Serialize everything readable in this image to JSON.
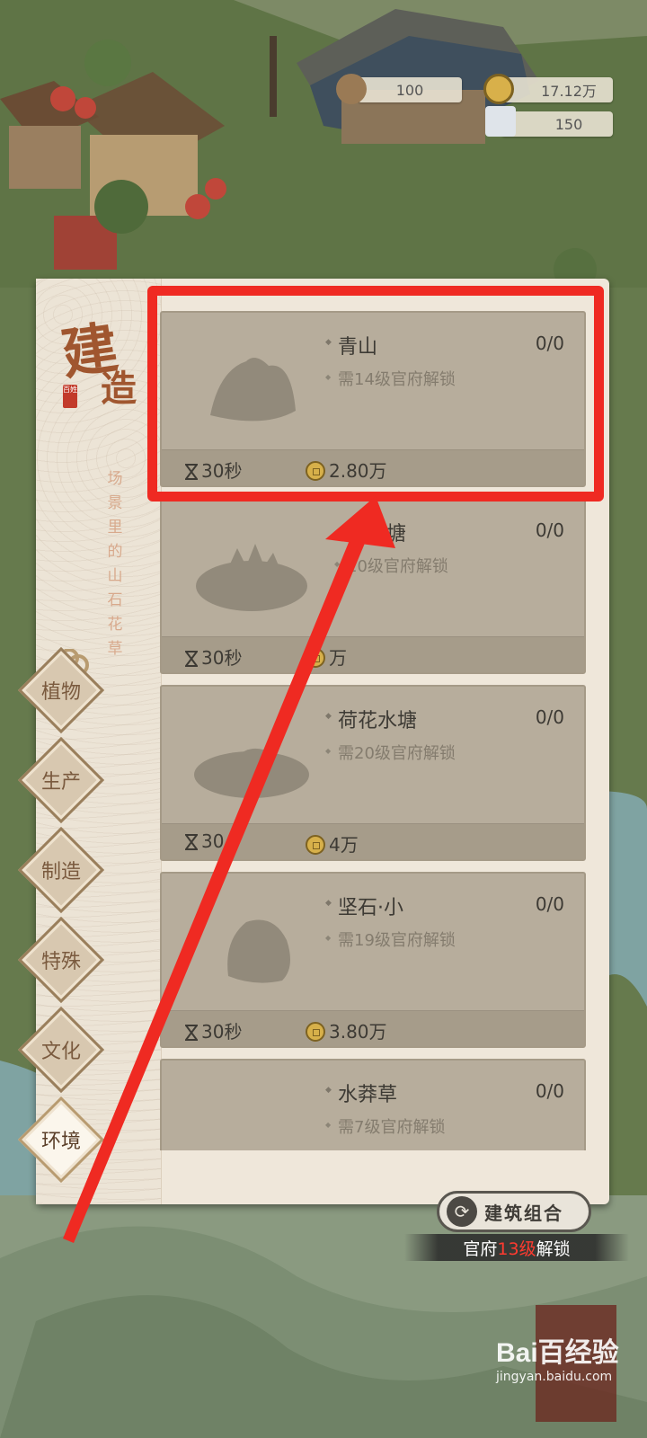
{
  "resources": {
    "wood": "100",
    "coins": "17.12万",
    "stone": "150"
  },
  "panel": {
    "title_char1": "建",
    "title_char2": "造",
    "seal_text": "百姓",
    "description": "场景里的山石花草"
  },
  "categories": [
    {
      "label": "植物",
      "active": false
    },
    {
      "label": "生产",
      "active": false
    },
    {
      "label": "制造",
      "active": false
    },
    {
      "label": "特殊",
      "active": false
    },
    {
      "label": "文化",
      "active": false
    },
    {
      "label": "环境",
      "active": true
    }
  ],
  "items": [
    {
      "name": "青山",
      "count": "0/0",
      "requirement": "需14级官府解锁",
      "time": "30秒",
      "cost": "2.80万"
    },
    {
      "name": "塘",
      "count": "0/0",
      "requirement": "10级官府解锁",
      "time": "30秒",
      "cost": "万"
    },
    {
      "name": "荷花水塘",
      "count": "0/0",
      "requirement": "需20级官府解锁",
      "time": "30",
      "cost": "4万"
    },
    {
      "name": "坚石·小",
      "count": "0/0",
      "requirement": "需19级官府解锁",
      "time": "30秒",
      "cost": "3.80万"
    },
    {
      "name": "水莽草",
      "count": "0/0",
      "requirement": "需7级官府解锁",
      "time": "",
      "cost": ""
    }
  ],
  "combo": {
    "label": "建筑组合",
    "unlock_prefix": "官府",
    "unlock_level": "13级",
    "unlock_suffix": "解锁"
  },
  "watermark": {
    "brand": "Bai百经验",
    "url": "jingyan.baidu.com"
  },
  "colors": {
    "highlight": "#ef2a22",
    "panel": "#efe7da",
    "card": "#b7ad9c",
    "title": "#a0562f"
  }
}
